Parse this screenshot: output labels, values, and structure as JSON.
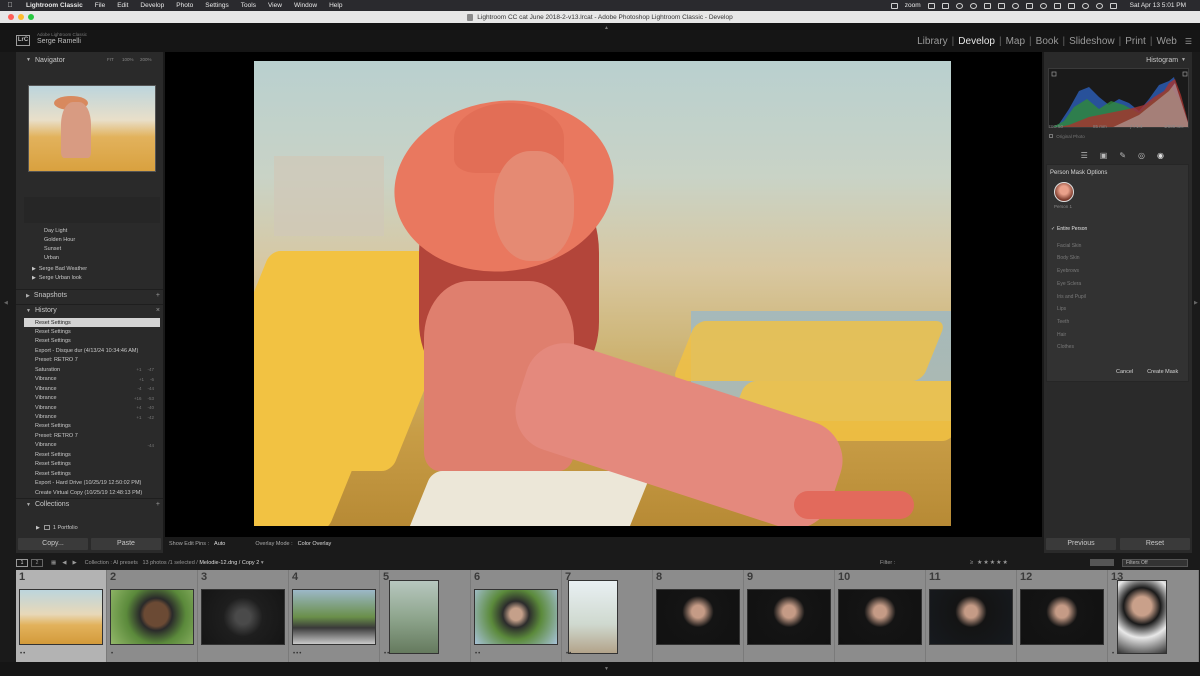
{
  "menubar": {
    "items": [
      "Lightroom Classic",
      "File",
      "Edit",
      "Develop",
      "Photo",
      "Settings",
      "Tools",
      "View",
      "Window",
      "Help"
    ],
    "zoom_label": "zoom",
    "datetime": "Sat Apr 13  5:01 PM"
  },
  "window": {
    "title": "Lightroom CC cat June 2018-2-v13.lrcat - Adobe Photoshop Lightroom Classic - Develop",
    "traffic_colors": [
      "#ff5f57",
      "#febc2e",
      "#28c840"
    ]
  },
  "identity": {
    "logo": "LrC",
    "line1": "Adobe Lightroom Classic",
    "line2": "Serge Ramelli"
  },
  "modules": [
    {
      "label": "Library",
      "active": false
    },
    {
      "label": "Develop",
      "active": true
    },
    {
      "label": "Map",
      "active": false
    },
    {
      "label": "Book",
      "active": false
    },
    {
      "label": "Slideshow",
      "active": false
    },
    {
      "label": "Print",
      "active": false
    },
    {
      "label": "Web",
      "active": false
    }
  ],
  "left": {
    "navigator": {
      "title": "Navigator",
      "zoom": [
        "FIT",
        "100%",
        "200%"
      ]
    },
    "presets": [
      "Day Light",
      "Golden Hour",
      "Sunset",
      "Urban"
    ],
    "preset_groups": [
      "Serge Bad Weather",
      "Serge Urban look"
    ],
    "snapshots": "Snapshots",
    "history": {
      "title": "History",
      "items": [
        {
          "label": "Reset Settings",
          "a": "",
          "b": ""
        },
        {
          "label": "Reset Settings",
          "a": "",
          "b": ""
        },
        {
          "label": "Reset Settings",
          "a": "",
          "b": ""
        },
        {
          "label": "Export - Disque dur (4/13/24 10:34:46 AM)",
          "a": "",
          "b": ""
        },
        {
          "label": "Preset: RETRO 7",
          "a": "",
          "b": ""
        },
        {
          "label": "Saturation",
          "a": "+1",
          "b": "-47"
        },
        {
          "label": "Vibrance",
          "a": "+1",
          "b": "-6"
        },
        {
          "label": "Vibrance",
          "a": "-4",
          "b": "-44"
        },
        {
          "label": "Vibrance",
          "a": "+16",
          "b": "-53"
        },
        {
          "label": "Vibrance",
          "a": "+4",
          "b": "-40"
        },
        {
          "label": "Vibrance",
          "a": "+1",
          "b": "-42"
        },
        {
          "label": "Reset Settings",
          "a": "",
          "b": ""
        },
        {
          "label": "Preset: RETRO 7",
          "a": "",
          "b": ""
        },
        {
          "label": "Vibrance",
          "a": "",
          "b": "-44"
        },
        {
          "label": "Reset Settings",
          "a": "",
          "b": ""
        },
        {
          "label": "Reset Settings",
          "a": "",
          "b": ""
        },
        {
          "label": "Reset Settings",
          "a": "",
          "b": ""
        },
        {
          "label": "Export - Hard Drive (10/25/19 12:50:02 PM)",
          "a": "",
          "b": ""
        },
        {
          "label": "Create Virtual Copy (10/25/19 12:48:13 PM)",
          "a": "",
          "b": ""
        }
      ]
    },
    "collections": {
      "title": "Collections",
      "item": "1 Portfolio"
    },
    "copy": "Copy...",
    "paste": "Paste"
  },
  "center": {
    "show_edit_pins_label": "Show Edit Pins :",
    "show_edit_pins_value": "Auto",
    "overlay_mode_label": "Overlay Mode :",
    "overlay_mode_value": "Color Overlay"
  },
  "right": {
    "histogram_title": "Histogram",
    "histogram_info": [
      "ISO 50",
      "85 mm",
      "ƒ / 1.4",
      "1/800 sec"
    ],
    "original_photo": "Original Photo",
    "mask": {
      "title": "Person Mask Options",
      "person_label": "Person 1",
      "options": [
        {
          "label": "Entire Person",
          "checked": true
        },
        {
          "label": "Facial Skin",
          "checked": false
        },
        {
          "label": "Body Skin",
          "checked": false
        },
        {
          "label": "Eyebrows",
          "checked": false
        },
        {
          "label": "Eye Sclera",
          "checked": false
        },
        {
          "label": "Iris and Pupil",
          "checked": false
        },
        {
          "label": "Lips",
          "checked": false
        },
        {
          "label": "Teeth",
          "checked": false
        },
        {
          "label": "Hair",
          "checked": false
        },
        {
          "label": "Clothes",
          "checked": false
        }
      ],
      "cancel": "Cancel",
      "create": "Create Mask"
    },
    "previous": "Previous",
    "reset": "Reset"
  },
  "filmbar": {
    "page1": "1",
    "page2": "2",
    "path_prefix": "Collection : AI presets",
    "path_count": "13 photos /1 selected /",
    "path_file": "Melodie-12.dng / Copy 2",
    "filter_label": "Filter :",
    "filter_value": "Filters Off"
  },
  "filmstrip": {
    "cells": [
      {
        "num": "1",
        "selected": true,
        "dots": "••"
      },
      {
        "num": "2",
        "selected": false,
        "dots": "•"
      },
      {
        "num": "3",
        "selected": false,
        "dots": ""
      },
      {
        "num": "4",
        "selected": false,
        "dots": "•••"
      },
      {
        "num": "5",
        "selected": false,
        "dots": "••"
      },
      {
        "num": "6",
        "selected": false,
        "dots": "••"
      },
      {
        "num": "7",
        "selected": false,
        "dots": "••"
      },
      {
        "num": "8",
        "selected": false,
        "dots": ""
      },
      {
        "num": "9",
        "selected": false,
        "dots": ""
      },
      {
        "num": "10",
        "selected": false,
        "dots": ""
      },
      {
        "num": "11",
        "selected": false,
        "dots": ""
      },
      {
        "num": "12",
        "selected": false,
        "dots": ""
      },
      {
        "num": "13",
        "selected": false,
        "dots": "•"
      }
    ]
  }
}
